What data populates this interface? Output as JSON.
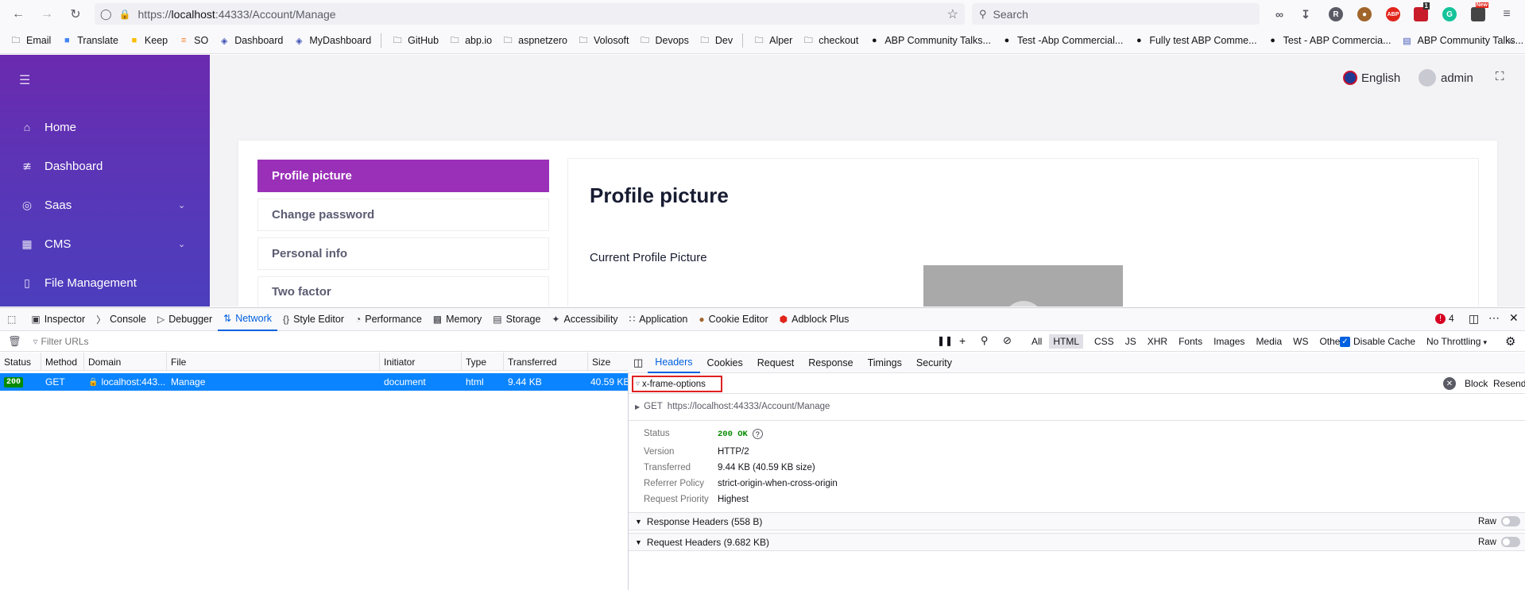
{
  "browser": {
    "url_scheme": "https://",
    "url_host": "localhost",
    "url_rest": ":44333/Account/Manage",
    "search_placeholder": "Search",
    "ext_new_badge": "New",
    "ext_count_badge": "1"
  },
  "bookmarks": [
    "Email",
    "Translate",
    "Keep",
    "SO",
    "Dashboard",
    "MyDashboard",
    "GitHub",
    "abp.io",
    "aspnetzero",
    "Volosoft",
    "Devops",
    "Dev",
    "Alper",
    "checkout",
    "ABP Community Talks...",
    "Test -Abp Commercial...",
    "Fully test ABP Comme...",
    "Test - ABP Commercia...",
    "ABP Community Talks..."
  ],
  "app": {
    "nav": [
      {
        "label": "Home",
        "icon": "home-icon"
      },
      {
        "label": "Dashboard",
        "icon": "chart-icon"
      },
      {
        "label": "Saas",
        "icon": "globe-icon"
      },
      {
        "label": "CMS",
        "icon": "cms-icon"
      },
      {
        "label": "File Management",
        "icon": "folder-icon"
      }
    ],
    "language": "English",
    "user": "admin",
    "profile_nav": [
      "Profile picture",
      "Change password",
      "Personal info",
      "Two factor"
    ],
    "panel_title": "Profile picture",
    "current_picture_label": "Current Profile Picture"
  },
  "devtools": {
    "tabs": [
      "Inspector",
      "Console",
      "Debugger",
      "Network",
      "Style Editor",
      "Performance",
      "Memory",
      "Storage",
      "Accessibility",
      "Application",
      "Cookie Editor",
      "Adblock Plus"
    ],
    "error_count": "4",
    "filter_placeholder": "Filter URLs",
    "type_filters": [
      "All",
      "HTML",
      "CSS",
      "JS",
      "XHR",
      "Fonts",
      "Images",
      "Media",
      "WS",
      "Other"
    ],
    "disable_cache": "Disable Cache",
    "throttling": "No Throttling",
    "columns": [
      "Status",
      "Method",
      "Domain",
      "File",
      "Initiator",
      "Type",
      "Transferred",
      "Size"
    ],
    "request": {
      "status": "200",
      "method": "GET",
      "domain": "localhost:443...",
      "file": "Manage",
      "initiator": "document",
      "type": "html",
      "transferred": "9.44 KB",
      "size": "40.59 KB"
    },
    "detail_tabs": [
      "Headers",
      "Cookies",
      "Request",
      "Response",
      "Timings",
      "Security"
    ],
    "header_filter": "x-frame-options",
    "block_label": "Block",
    "resend_label": "Resend",
    "get_label": "GET",
    "get_url": "https://localhost:44333/Account/Manage",
    "summary": [
      {
        "key": "Status",
        "value": "200 OK"
      },
      {
        "key": "Version",
        "value": "HTTP/2"
      },
      {
        "key": "Transferred",
        "value": "9.44 KB (40.59 KB size)"
      },
      {
        "key": "Referrer Policy",
        "value": "strict-origin-when-cross-origin"
      },
      {
        "key": "Request Priority",
        "value": "Highest"
      }
    ],
    "response_headers": "Response Headers (558 B)",
    "request_headers": "Request Headers (9.682 KB)",
    "raw_label": "Raw"
  }
}
